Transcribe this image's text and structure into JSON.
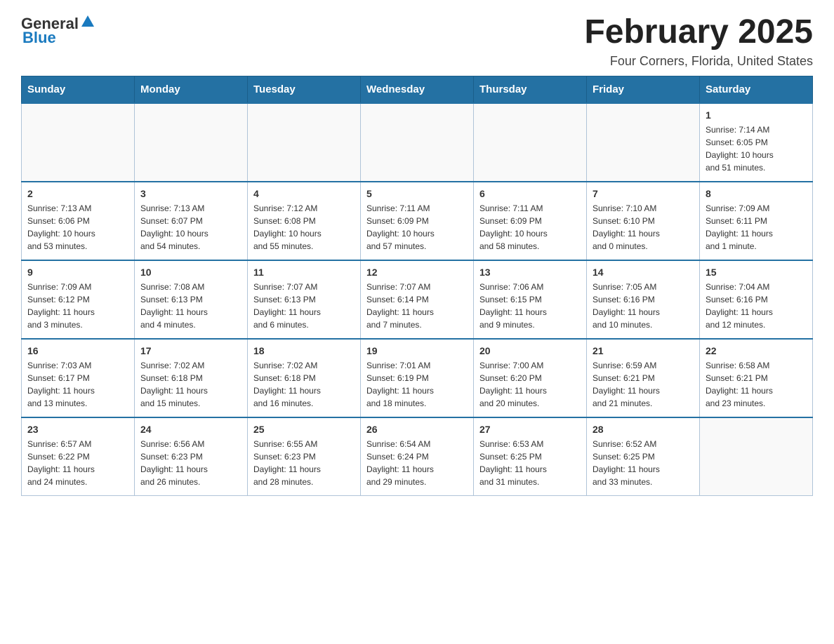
{
  "header": {
    "logo": {
      "general": "General",
      "blue": "Blue"
    },
    "title": "February 2025",
    "subtitle": "Four Corners, Florida, United States"
  },
  "weekdays": [
    "Sunday",
    "Monday",
    "Tuesday",
    "Wednesday",
    "Thursday",
    "Friday",
    "Saturday"
  ],
  "weeks": [
    [
      {
        "day": "",
        "info": ""
      },
      {
        "day": "",
        "info": ""
      },
      {
        "day": "",
        "info": ""
      },
      {
        "day": "",
        "info": ""
      },
      {
        "day": "",
        "info": ""
      },
      {
        "day": "",
        "info": ""
      },
      {
        "day": "1",
        "info": "Sunrise: 7:14 AM\nSunset: 6:05 PM\nDaylight: 10 hours\nand 51 minutes."
      }
    ],
    [
      {
        "day": "2",
        "info": "Sunrise: 7:13 AM\nSunset: 6:06 PM\nDaylight: 10 hours\nand 53 minutes."
      },
      {
        "day": "3",
        "info": "Sunrise: 7:13 AM\nSunset: 6:07 PM\nDaylight: 10 hours\nand 54 minutes."
      },
      {
        "day": "4",
        "info": "Sunrise: 7:12 AM\nSunset: 6:08 PM\nDaylight: 10 hours\nand 55 minutes."
      },
      {
        "day": "5",
        "info": "Sunrise: 7:11 AM\nSunset: 6:09 PM\nDaylight: 10 hours\nand 57 minutes."
      },
      {
        "day": "6",
        "info": "Sunrise: 7:11 AM\nSunset: 6:09 PM\nDaylight: 10 hours\nand 58 minutes."
      },
      {
        "day": "7",
        "info": "Sunrise: 7:10 AM\nSunset: 6:10 PM\nDaylight: 11 hours\nand 0 minutes."
      },
      {
        "day": "8",
        "info": "Sunrise: 7:09 AM\nSunset: 6:11 PM\nDaylight: 11 hours\nand 1 minute."
      }
    ],
    [
      {
        "day": "9",
        "info": "Sunrise: 7:09 AM\nSunset: 6:12 PM\nDaylight: 11 hours\nand 3 minutes."
      },
      {
        "day": "10",
        "info": "Sunrise: 7:08 AM\nSunset: 6:13 PM\nDaylight: 11 hours\nand 4 minutes."
      },
      {
        "day": "11",
        "info": "Sunrise: 7:07 AM\nSunset: 6:13 PM\nDaylight: 11 hours\nand 6 minutes."
      },
      {
        "day": "12",
        "info": "Sunrise: 7:07 AM\nSunset: 6:14 PM\nDaylight: 11 hours\nand 7 minutes."
      },
      {
        "day": "13",
        "info": "Sunrise: 7:06 AM\nSunset: 6:15 PM\nDaylight: 11 hours\nand 9 minutes."
      },
      {
        "day": "14",
        "info": "Sunrise: 7:05 AM\nSunset: 6:16 PM\nDaylight: 11 hours\nand 10 minutes."
      },
      {
        "day": "15",
        "info": "Sunrise: 7:04 AM\nSunset: 6:16 PM\nDaylight: 11 hours\nand 12 minutes."
      }
    ],
    [
      {
        "day": "16",
        "info": "Sunrise: 7:03 AM\nSunset: 6:17 PM\nDaylight: 11 hours\nand 13 minutes."
      },
      {
        "day": "17",
        "info": "Sunrise: 7:02 AM\nSunset: 6:18 PM\nDaylight: 11 hours\nand 15 minutes."
      },
      {
        "day": "18",
        "info": "Sunrise: 7:02 AM\nSunset: 6:18 PM\nDaylight: 11 hours\nand 16 minutes."
      },
      {
        "day": "19",
        "info": "Sunrise: 7:01 AM\nSunset: 6:19 PM\nDaylight: 11 hours\nand 18 minutes."
      },
      {
        "day": "20",
        "info": "Sunrise: 7:00 AM\nSunset: 6:20 PM\nDaylight: 11 hours\nand 20 minutes."
      },
      {
        "day": "21",
        "info": "Sunrise: 6:59 AM\nSunset: 6:21 PM\nDaylight: 11 hours\nand 21 minutes."
      },
      {
        "day": "22",
        "info": "Sunrise: 6:58 AM\nSunset: 6:21 PM\nDaylight: 11 hours\nand 23 minutes."
      }
    ],
    [
      {
        "day": "23",
        "info": "Sunrise: 6:57 AM\nSunset: 6:22 PM\nDaylight: 11 hours\nand 24 minutes."
      },
      {
        "day": "24",
        "info": "Sunrise: 6:56 AM\nSunset: 6:23 PM\nDaylight: 11 hours\nand 26 minutes."
      },
      {
        "day": "25",
        "info": "Sunrise: 6:55 AM\nSunset: 6:23 PM\nDaylight: 11 hours\nand 28 minutes."
      },
      {
        "day": "26",
        "info": "Sunrise: 6:54 AM\nSunset: 6:24 PM\nDaylight: 11 hours\nand 29 minutes."
      },
      {
        "day": "27",
        "info": "Sunrise: 6:53 AM\nSunset: 6:25 PM\nDaylight: 11 hours\nand 31 minutes."
      },
      {
        "day": "28",
        "info": "Sunrise: 6:52 AM\nSunset: 6:25 PM\nDaylight: 11 hours\nand 33 minutes."
      },
      {
        "day": "",
        "info": ""
      }
    ]
  ]
}
